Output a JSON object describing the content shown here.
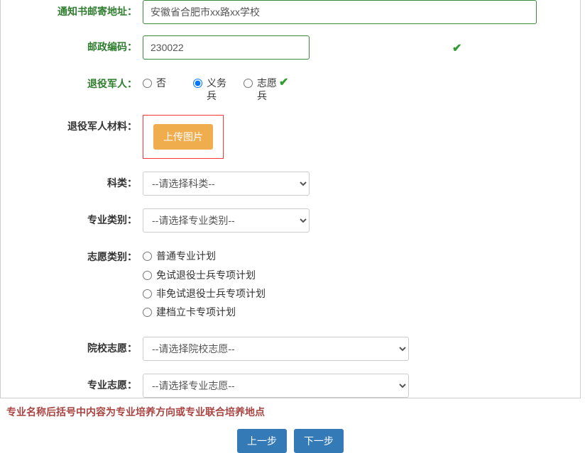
{
  "labels": {
    "address": "通知书邮寄地址：",
    "postcode": "邮政编码：",
    "veteran": "退役军人：",
    "veteranMaterial": "退役军人材料：",
    "subject": "科类：",
    "majorCategory": "专业类别：",
    "applicationCategory": "志愿类别：",
    "schoolChoice": "院校志愿：",
    "majorChoice": "专业志愿："
  },
  "values": {
    "address": "安徽省合肥市xx路xx学校",
    "postcode": "230022"
  },
  "veteranOptions": {
    "no": "否",
    "compulsory": "义务兵",
    "volunteer": "志愿兵"
  },
  "applicationOptions": {
    "opt1": "普通专业计划",
    "opt2": "免试退役士兵专项计划",
    "opt3": "非免试退役士兵专项计划",
    "opt4": "建档立卡专项计划"
  },
  "placeholders": {
    "subject": "--请选择科类--",
    "majorCategory": "--请选择专业类别--",
    "schoolChoice": "--请选择院校志愿--",
    "majorChoice": "--请选择专业志愿--"
  },
  "buttons": {
    "upload": "上传图片",
    "prev": "上一步",
    "next": "下一步"
  },
  "hint": "专业名称后括号中内容为专业培养方向或专业联合培养地点"
}
